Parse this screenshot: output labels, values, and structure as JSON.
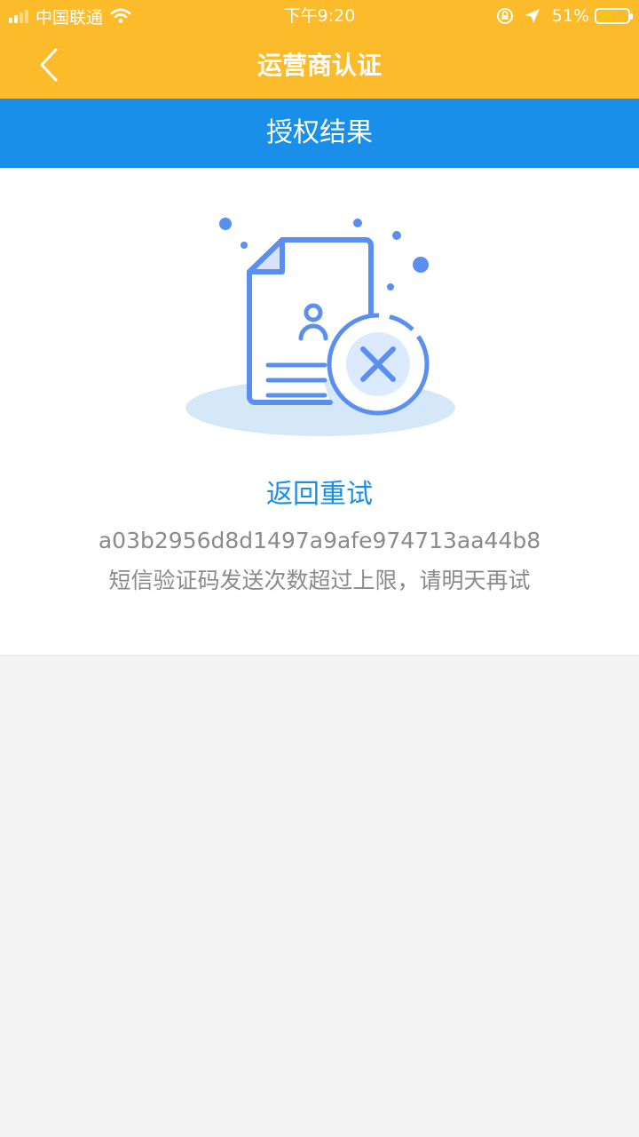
{
  "status_bar": {
    "carrier": "中国联通",
    "time": "下午9:20",
    "battery_percent": "51%",
    "battery_level": 0.51,
    "icons": [
      "signal-icon",
      "wifi-icon",
      "orientation-lock-icon",
      "location-arrow-icon",
      "battery-icon"
    ]
  },
  "nav": {
    "title": "运营商认证",
    "back_icon": "chevron-left-icon"
  },
  "section": {
    "title": "授权结果"
  },
  "result": {
    "illustration": "document-error-icon",
    "retry_label": "返回重试",
    "error_code": "a03b2956d8d1497a9afe974713aa44b8",
    "error_message": "短信验证码发送次数超过上限，请明天再试"
  },
  "colors": {
    "nav_background": "#fbbb2b",
    "section_background": "#1a8fea",
    "link": "#1a8fea",
    "secondary_text": "#8a8a8a",
    "illustration_stroke": "#5b8fef"
  }
}
